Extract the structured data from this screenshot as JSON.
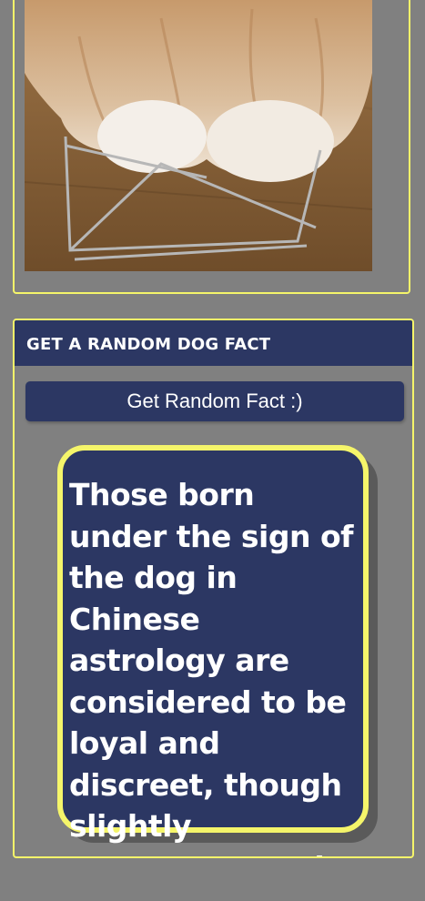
{
  "photo": {
    "alt_icon": "dog-photo"
  },
  "fact_section": {
    "title": "GET A RANDOM DOG FACT",
    "button_label": "Get Random Fact :)",
    "fact_text": "Those born under the sign of the dog in Chinese astrology are considered to be loyal and discreet, though slightly temperamental."
  },
  "colors": {
    "page_background": "#808080",
    "card_border": "#f5f56a",
    "navy": "#2c3763",
    "text": "#ffffff"
  }
}
